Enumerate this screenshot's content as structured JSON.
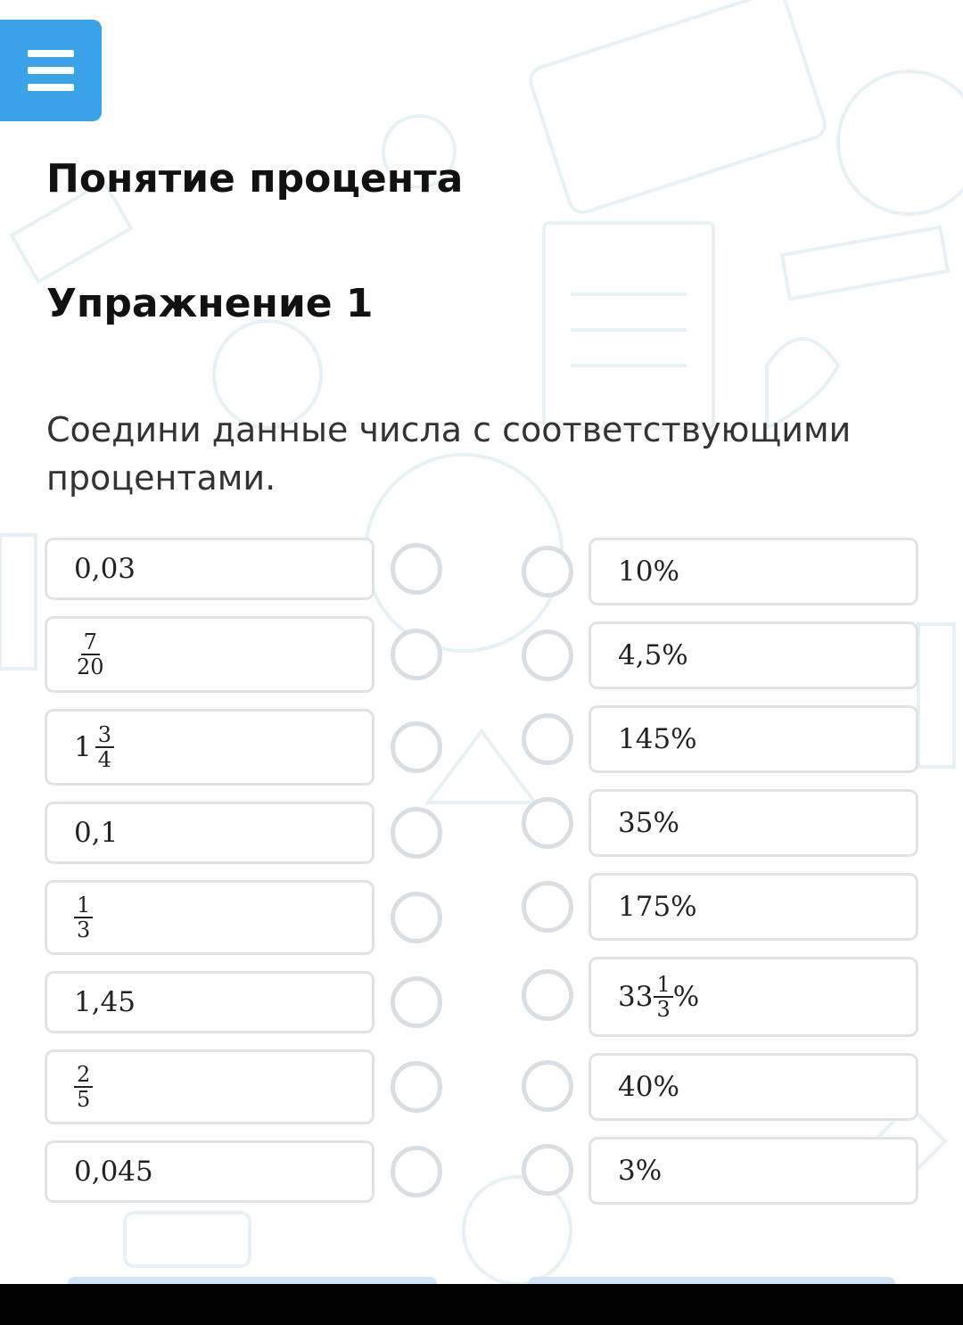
{
  "header": {
    "menu_icon": "hamburger-menu-icon",
    "accent_color": "#3aa3e8",
    "title": "Понятие процента",
    "subtitle": "Упражнение 1"
  },
  "task": {
    "instruction": "Соедини данные числа с соответствующими процентами."
  },
  "left_items": [
    {
      "text": "0,03"
    },
    {
      "num": "7",
      "den": "20"
    },
    {
      "whole": "1",
      "num": "3",
      "den": "4"
    },
    {
      "text": "0,1"
    },
    {
      "num": "1",
      "den": "3"
    },
    {
      "text": "1,45"
    },
    {
      "num": "2",
      "den": "5"
    },
    {
      "text": "0,045"
    }
  ],
  "right_items": [
    {
      "text": "10%"
    },
    {
      "text": "4,5%"
    },
    {
      "text": "145%"
    },
    {
      "text": "35%"
    },
    {
      "text": "175%"
    },
    {
      "whole": "33",
      "num": "1",
      "den": "3",
      "suffix": "%"
    },
    {
      "text": "40%"
    },
    {
      "text": "3%"
    }
  ]
}
